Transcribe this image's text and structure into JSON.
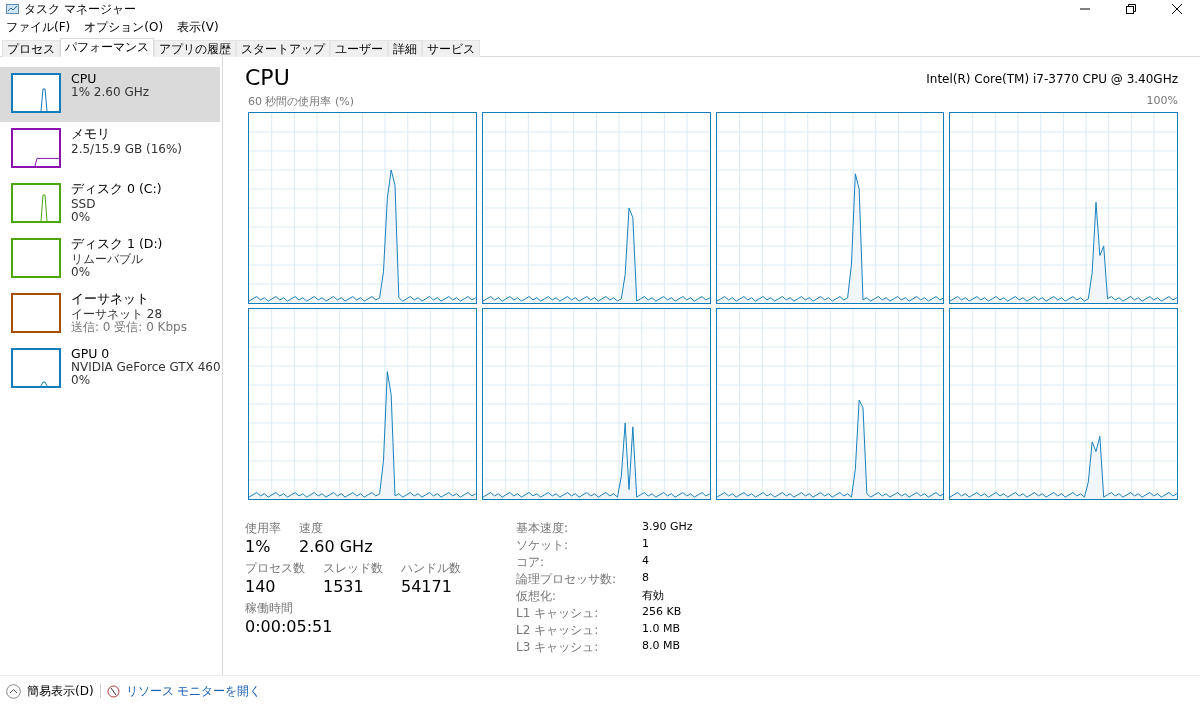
{
  "window": {
    "title": "タスク マネージャー"
  },
  "menu": [
    "ファイル(F)",
    "オプション(O)",
    "表示(V)"
  ],
  "tabs": [
    {
      "label": "プロセス",
      "selected": false
    },
    {
      "label": "パフォーマンス",
      "selected": true
    },
    {
      "label": "アプリの履歴",
      "selected": false
    },
    {
      "label": "スタートアップ",
      "selected": false
    },
    {
      "label": "ユーザー",
      "selected": false
    },
    {
      "label": "詳細",
      "selected": false
    },
    {
      "label": "サービス",
      "selected": false
    }
  ],
  "sidebar": {
    "items": [
      {
        "name": "CPU",
        "lines": [
          "1%  2.60 GHz"
        ],
        "color": "#117dbb",
        "selected": true
      },
      {
        "name": "メモリ",
        "lines": [
          "2.5/15.9 GB (16%)"
        ],
        "color": "#8b12ae",
        "selected": false
      },
      {
        "name": "ディスク 0 (C:)",
        "lines": [
          "SSD",
          "0%"
        ],
        "color": "#4da60c",
        "selected": false
      },
      {
        "name": "ディスク 1 (D:)",
        "lines": [
          "リムーバブル",
          "0%"
        ],
        "color": "#4da60c",
        "selected": false
      },
      {
        "name": "イーサネット",
        "lines": [
          "イーサネット 28",
          "送信: 0 受信: 0 Kbps"
        ],
        "color": "#a74f01",
        "selected": false
      },
      {
        "name": "GPU 0",
        "lines": [
          "NVIDIA GeForce GTX 460",
          "0%"
        ],
        "color": "#117dbb",
        "selected": false
      }
    ]
  },
  "main": {
    "title": "CPU",
    "processor": "Intel(R) Core(TM) i7-3770 CPU @ 3.40GHz",
    "graph_caption": "60 秒間の使用率 (%)",
    "graph_max": "100%",
    "stat_rows": [
      [
        {
          "label": "使用率",
          "value": "1%"
        },
        {
          "label": "速度",
          "value": "2.60 GHz"
        }
      ],
      [
        {
          "label": "プロセス数",
          "value": "140"
        },
        {
          "label": "スレッド数",
          "value": "1531"
        },
        {
          "label": "ハンドル数",
          "value": "54171"
        }
      ],
      [
        {
          "label": "稼働時間",
          "value": "0:00:05:51"
        }
      ]
    ],
    "details": [
      {
        "label": "基本速度:",
        "value": "3.90 GHz"
      },
      {
        "label": "ソケット:",
        "value": "1"
      },
      {
        "label": "コア:",
        "value": "4"
      },
      {
        "label": "論理プロセッサ数:",
        "value": "8"
      },
      {
        "label": "仮想化:",
        "value": "有効"
      },
      {
        "label": "L1 キャッシュ:",
        "value": "256 KB"
      },
      {
        "label": "L2 キャッシュ:",
        "value": "1.0 MB"
      },
      {
        "label": "L3 キャッシュ:",
        "value": "8.0 MB"
      }
    ]
  },
  "footer": {
    "collapse": "簡易表示(D)",
    "link": "リソース モニターを開く"
  }
}
